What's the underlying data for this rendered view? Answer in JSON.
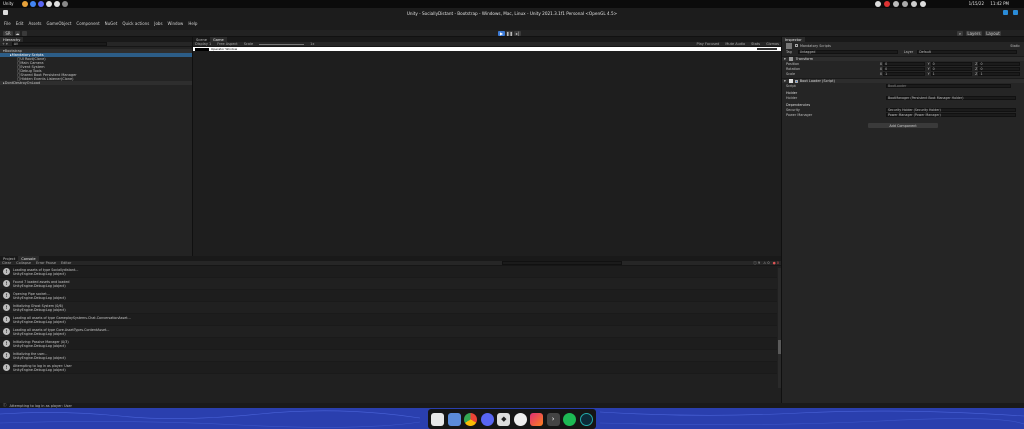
{
  "os_bar": {
    "app_name": "Unity",
    "clock": "11:42 PM",
    "date": "1/15/22"
  },
  "window": {
    "title": "Unity - SociallyDistant - Bootstrap - Windows, Mac, Linux - Unity 2021.3.1f1 Personal <OpenGL 4.5>"
  },
  "menu": [
    "File",
    "Edit",
    "Assets",
    "GameObject",
    "Component",
    "NuGet",
    "Quick actions",
    "Jobs",
    "Window",
    "Help"
  ],
  "toolbar": {
    "account_label": "SR",
    "layers_label": "Layers",
    "layout_label": "Layout"
  },
  "hierarchy": {
    "tab": "Hierarchy",
    "search_placeholder": "All",
    "items": [
      {
        "label": "Bootstrap",
        "depth": 0,
        "kind": "scene"
      },
      {
        "label": "Mandatory Scripts",
        "depth": 1,
        "kind": "selected"
      },
      {
        "label": "UI Root(Clone)",
        "depth": 2,
        "kind": "normal"
      },
      {
        "label": "Main Camera",
        "depth": 2,
        "kind": "normal"
      },
      {
        "label": "Event System",
        "depth": 2,
        "kind": "normal"
      },
      {
        "label": "Debug Tools",
        "depth": 2,
        "kind": "normal"
      },
      {
        "label": "Shared Boot Persistent Manager",
        "depth": 2,
        "kind": "normal"
      },
      {
        "label": "Hidden Events Listener(Clone)",
        "depth": 2,
        "kind": "normal"
      },
      {
        "label": "DontDestroyOnLoad",
        "depth": 0,
        "kind": "scene"
      }
    ]
  },
  "scene_view": {
    "tabs": [
      "Scene",
      "Game"
    ],
    "active_tab": "Game",
    "display": "Display 1",
    "aspect": "Free Aspect",
    "scale_label": "Scale",
    "scale_value": "1x",
    "play_focused": "Play Focused",
    "mute_audio": "Mute Audio",
    "stats": "Stats",
    "gizmos": "Gizmos",
    "game_bar_text": "Operator Window"
  },
  "inspector": {
    "tab": "Inspector",
    "object_name": "Mandatory Scripts",
    "static_label": "Static",
    "tag_label": "Tag",
    "tag_value": "Untagged",
    "layer_label": "Layer",
    "layer_value": "Default",
    "transform": {
      "title": "Transform",
      "rows": [
        {
          "label": "Position",
          "x": "0",
          "y": "0",
          "z": "0"
        },
        {
          "label": "Rotation",
          "x": "0",
          "y": "0",
          "z": "0"
        },
        {
          "label": "Scale",
          "x": "1",
          "y": "1",
          "z": "1"
        }
      ]
    },
    "boot_loader": {
      "title": "Boot Loader (Script)",
      "script_label": "Script",
      "script_value": "BootLoader",
      "holder_header": "Holder",
      "holder_label": "Holder",
      "holder_value": "BootManager (Persistent Boot Manager Holder)",
      "deps_header": "Dependencies",
      "deps": [
        {
          "label": "Security",
          "value": "Security Holder (Security Holder)"
        },
        {
          "label": "Power Manager",
          "value": "Power Manager (Power Manager)"
        }
      ]
    },
    "add_component": "Add Component"
  },
  "console": {
    "tabs": [
      "Project",
      "Console"
    ],
    "active_tab": "Console",
    "toolbar": [
      "Clear",
      "Collapse",
      "Error Pause",
      "Editor"
    ],
    "counts": {
      "info": "9",
      "warn": "0",
      "error": "0"
    },
    "logs": [
      {
        "line1": "Loading assets of type Sociallydistant...",
        "line2": "UnityEngine.Debug:Log (object)"
      },
      {
        "line1": "Found 7 loaded assets and loaded",
        "line2": "UnityEngine.Debug:Log (object)"
      },
      {
        "line1": "Opening Pipe socket...",
        "line2": "UnityEngine.Debug:Log (object)"
      },
      {
        "line1": "Initializing Ghost System (0/6)",
        "line2": "UnityEngine.Debug:Log (object)"
      },
      {
        "line1": "Loading all assets of type GameplaySystems.Chat.ConversationAsset...",
        "line2": "UnityEngine.Debug:Log (object)"
      },
      {
        "line1": "Loading all assets of type Core.AssetTypes.ContentAsset...",
        "line2": "UnityEngine.Debug:Log (object)"
      },
      {
        "line1": "Initializing: Passive Manager (0/3)",
        "line2": "UnityEngine.Debug:Log (object)"
      },
      {
        "line1": "Initializing the user...",
        "line2": "UnityEngine.Debug:Log (object)"
      },
      {
        "line1": "Attempting to log in as player: User",
        "line2": "UnityEngine.Debug:Log (object)"
      }
    ]
  },
  "status_bar": {
    "message": "Attempting to log in as player: User"
  },
  "dock": {
    "apps": [
      "files-icon",
      "file-manager-icon",
      "chrome-icon",
      "discord-icon",
      "unity-icon",
      "steam-icon",
      "rider-icon",
      "terminal-icon",
      "spotify-icon",
      "monitor-icon"
    ]
  },
  "colors": {
    "selection": "#2c5d87",
    "desktop": "#2a3fae",
    "play_button": "#3d7bd6"
  }
}
